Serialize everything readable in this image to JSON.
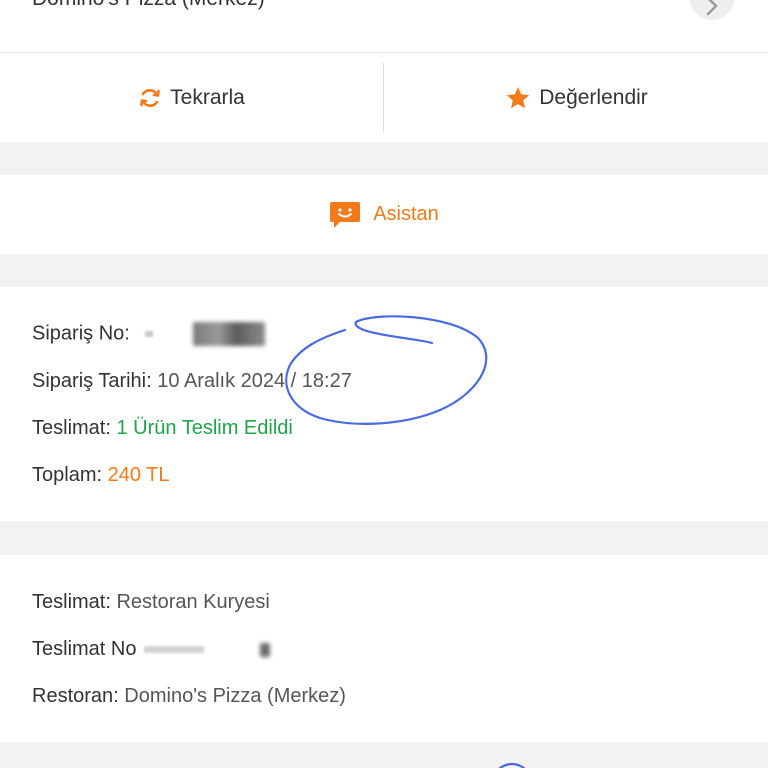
{
  "header": {
    "restaurant_name": "Domino's Pizza (Merkez)"
  },
  "actions": {
    "repeat_label": "Tekrarla",
    "rate_label": "Değerlendir"
  },
  "assistant": {
    "label": "Asistan"
  },
  "order": {
    "order_no_label": "Sipariş No:",
    "order_date_label": "Sipariş Tarihi:",
    "order_date_value": "10 Aralık 2024 / 18:27",
    "delivery_label": "Teslimat:",
    "delivery_value": "1 Ürün Teslim Edildi",
    "total_label": "Toplam:",
    "total_value": "240 TL"
  },
  "details": {
    "delivery_label": "Teslimat:",
    "delivery_value": "Restoran Kuryesi",
    "delivery_no_label": "Teslimat No",
    "restaurant_label": "Restoran:",
    "restaurant_value": "Domino's Pizza (Merkez)"
  },
  "colors": {
    "accent": "#f27a1a",
    "success": "#1fa64a",
    "annotation": "#4a6ae0"
  },
  "icons": {
    "repeat": "refresh-icon",
    "rate": "star-icon",
    "assistant": "chat-smile-icon",
    "header_button": "chevron-right-icon"
  }
}
